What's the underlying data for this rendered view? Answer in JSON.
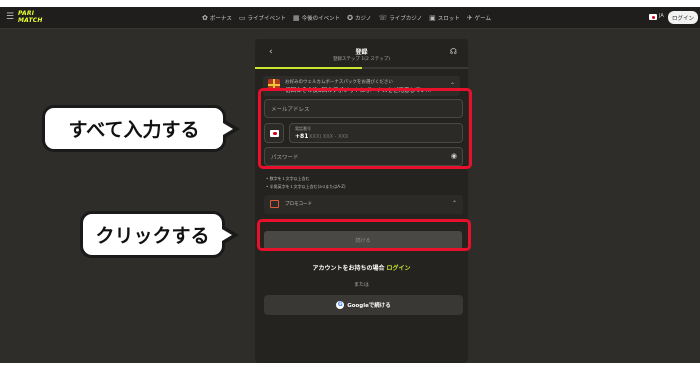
{
  "header": {
    "logo_line1": "PARI",
    "logo_line2": "MATCH",
    "nav": [
      {
        "icon": "gift-icon",
        "glyph": "✿",
        "label": "ボーナス"
      },
      {
        "icon": "live-event-icon",
        "glyph": "▭",
        "label": "ライブイベント"
      },
      {
        "icon": "calendar-icon",
        "glyph": "▦",
        "label": "今後のイベント"
      },
      {
        "icon": "casino-icon",
        "glyph": "✪",
        "label": "カジノ"
      },
      {
        "icon": "live-casino-icon",
        "glyph": "☏",
        "label": "ライブカジノ"
      },
      {
        "icon": "slot-icon",
        "glyph": "▣",
        "label": "スロット"
      },
      {
        "icon": "game-icon",
        "glyph": "✈",
        "label": "ゲーム"
      }
    ],
    "lang": "JA",
    "login": "ログイン"
  },
  "modal": {
    "title": "登録",
    "subtitle": "登録ステップ 1(2 ステップ)",
    "progress_fraction": 0.5,
    "bonus_line1": "お好みのウェルカムボーナスパックをお選びください",
    "bonus_line2": "初回＆その後3回のデポジットにボーナスをご用意してい...",
    "email_placeholder": "メールアドレス",
    "phone_label": "電話番号",
    "phone_code": "+81",
    "phone_placeholder": "XXX) XXX - XXX",
    "password_placeholder": "パスワード",
    "rule1": "数字を１文字以上含む",
    "rule2": "半角英字を１文字以上含む(a-zまたはA-Z)",
    "promo_label": "プロモコード",
    "continue_label": "続ける",
    "have_account": "アカウントをお持ちの場合",
    "login_link": "ログイン",
    "or": "または",
    "google_label": "Googleで続ける"
  },
  "annotations": {
    "callout1": "すべて入力する",
    "callout2": "クリックする",
    "highlight_color": "#e8102a"
  }
}
